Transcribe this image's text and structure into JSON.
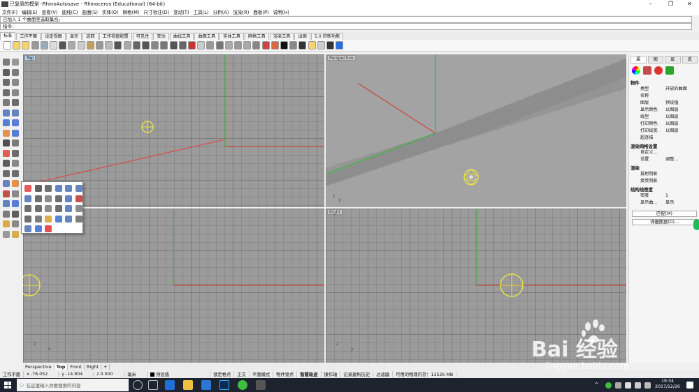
{
  "window": {
    "title": "已复原的模型 -RhinoAutosave - Rhinoceros (Educational) (64-bit)",
    "controls": [
      "–",
      "❐",
      "✕"
    ]
  },
  "menu": [
    "文件(F)",
    "编辑(E)",
    "查看(V)",
    "曲线(C)",
    "曲面(S)",
    "实体(O)",
    "网格(M)",
    "尺寸标注(D)",
    "变动(T)",
    "工具(L)",
    "分析(A)",
    "渲染(R)",
    "面板(P)",
    "说明(H)"
  ],
  "command": {
    "history": "已加入 1 个曲面至选取集合。",
    "prompt": "指令:"
  },
  "toolbar_tabs": [
    "标准",
    "工作平面",
    "设定视图",
    "显示",
    "选取",
    "工作视窗配置",
    "可见性",
    "变动",
    "曲线工具",
    "曲面工具",
    "实体工具",
    "网格工具",
    "渲染工具",
    "出图",
    "5.0 的新功能"
  ],
  "viewports": {
    "top": {
      "label": "Top"
    },
    "perspective": {
      "label": "Perspective"
    },
    "front": {
      "label": ""
    },
    "right": {
      "label": "Right"
    }
  },
  "viewport_tabs": [
    "Perspective",
    "Top",
    "Front",
    "Right",
    "+"
  ],
  "properties": {
    "tabs": [
      "属",
      "图",
      "显",
      "说"
    ],
    "section_object": "物件",
    "rows": [
      {
        "label": "类型",
        "value": "开放的曲面"
      },
      {
        "label": "名称",
        "value": ""
      },
      {
        "label": "图层",
        "value": "预设值"
      },
      {
        "label": "显示颜色",
        "value": "以图层"
      },
      {
        "label": "线型",
        "value": "以图层"
      },
      {
        "label": "打印颜色",
        "value": "以图层"
      },
      {
        "label": "打印线宽",
        "value": "以图层"
      },
      {
        "label": "超连结",
        "value": ""
      }
    ],
    "section_mesh": "渲染网格设置",
    "mesh_rows": [
      {
        "label": "自定义...",
        "value": ""
      },
      {
        "label": "设置",
        "value": "调整..."
      }
    ],
    "section_render": "渲染",
    "render_rows": [
      {
        "label": "投射阴影",
        "value": ""
      },
      {
        "label": "接受阴影",
        "value": ""
      }
    ],
    "section_iso": "结构线密度",
    "iso_rows": [
      {
        "label": "密度",
        "value": "1"
      },
      {
        "label": "显示曲...",
        "value": "显示"
      }
    ],
    "buttons": [
      "匹配(M)",
      "详细数据(D)..."
    ]
  },
  "status": {
    "workplane": "工作平面",
    "x": "x -76.052",
    "y": "y -14.904",
    "z": "z 0.000",
    "unit": "毫米",
    "layer": "预设值",
    "toggles": [
      "锁定格点",
      "正交",
      "平面模式",
      "物件锁点",
      "智慧轨迹",
      "操作轴",
      "记录建构历史",
      "过滤器",
      "可用的物理内存：13526 MB"
    ]
  },
  "taskbar": {
    "search_placeholder": "在这里输入你要搜索的内容",
    "time": "19:34",
    "date": "2017/12/26"
  },
  "watermark": {
    "text": "Bai 经验",
    "url": "jingyan.baidu.com"
  },
  "colors": {
    "accent": "#b7d4ef",
    "x_axis": "#c94a3f",
    "y_axis": "#3bb33b",
    "object": "#e5e04a"
  }
}
